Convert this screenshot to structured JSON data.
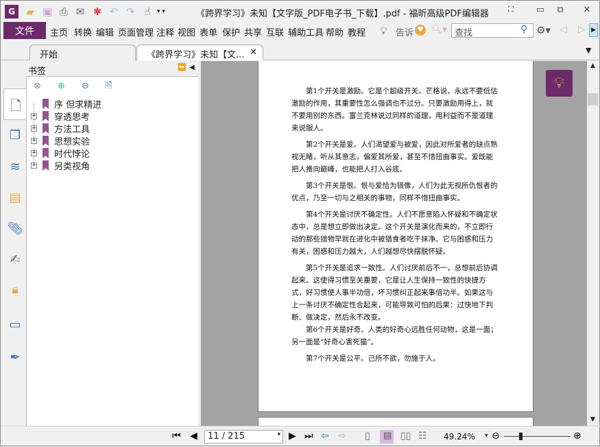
{
  "window": {
    "title": "《跨界学习》未知【文字版_PDF电子书_下载】.pdf - 福昕高级PDF编辑器",
    "minimize": "▭",
    "restore": "⧉",
    "close": "✕"
  },
  "quick_access": [
    "app-logo-icon",
    "open-folder-icon",
    "save-icon",
    "print-icon",
    "email-icon",
    "new-icon",
    "undo-icon",
    "redo-icon",
    "hand-tool-icon",
    "customize-dropdown-icon"
  ],
  "menu": {
    "file": "文件",
    "items": [
      "主页",
      "转换",
      "编辑",
      "页面管理",
      "注释",
      "视图",
      "表单",
      "保护",
      "共享",
      "互联",
      "辅助工具",
      "帮助",
      "教程"
    ],
    "tell_me": "告诉",
    "search_placeholder": "查找"
  },
  "tabs": [
    {
      "label": "开始"
    },
    {
      "label": "《跨界学习》未知【文..."
    }
  ],
  "panel": {
    "title": "书签",
    "bookmarks": [
      {
        "label": "序 但求精进",
        "expandable": false
      },
      {
        "label": "穿透思考",
        "expandable": true
      },
      {
        "label": "方法工具",
        "expandable": true
      },
      {
        "label": "思想实验",
        "expandable": true
      },
      {
        "label": "时代悖论",
        "expandable": true
      },
      {
        "label": "另类视角",
        "expandable": true
      }
    ]
  },
  "document": {
    "paragraphs": [
      "第1个开关是激励。它是个超级开关。芒格说，永远不要低估激励的作用，其重要性怎么强调也不过分。只要激励用得上，就不要用别的东西。富兰克林说过同样的道理，用利益而不是道理来说服人。",
      "第2个开关是爱。人们渴望爱与被爱，因此对所爱者的缺点熟视无睹，听从其意志，偏爱其所爱，甚至不惜扭曲事实。爱既能把人推向巅峰，也能把人打入谷底。",
      "第3个开关是恨。恨与爱恰为镜像，人们为此无视所仇恨者的优点，乃至一切与之相关的事物，同样不惜扭曲事实。",
      "第4个开关是讨厌不确定性。人们不愿意陷入怀疑和不确定状态中，总是想立即做出决定。这个开关是演化而来的，不立即行动的那些猎物早就在进化中被猎食者吃干抹净。它与困惑和压力有关，困惑和压力越大，人们越想尽快摆脱怀疑。",
      "第5个开关是追求一致性。人们讨厌前后不一，总想前后协调起来。这使得习惯至关重要，它是让人生保持一致性的快捷方式，好习惯使人事半功倍，坏习惯纠正起来事倍功半。如果这与上一条讨厌不确定性合起来，可能导致可怕的后果：过快地下判断、做决定，然后永不改变。",
      "第6个开关是好奇。人类的好奇心远胜任何动物，这是一面；另一面是“好奇心害死猫”。",
      "第7个开关是公平。己所不欲，勿施于人。"
    ]
  },
  "status": {
    "page": "11 / 215",
    "zoom": "49.24%",
    "zoom_slider_percent": 25
  },
  "colors": {
    "accent": "#6c2a6a",
    "bookmark": "#94558f",
    "doc_bg": "#a3a3a3"
  }
}
